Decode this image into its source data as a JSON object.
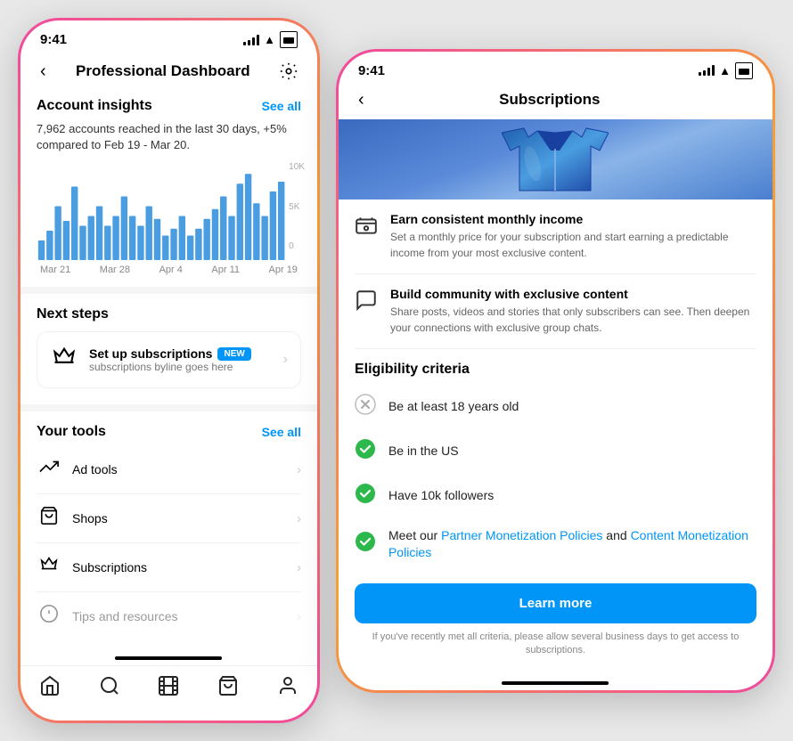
{
  "left_phone": {
    "status": {
      "time": "9:41"
    },
    "header": {
      "title": "Professional Dashboard",
      "back_label": "‹",
      "settings_icon": "⚙"
    },
    "account_insights": {
      "section_title": "Account insights",
      "see_all": "See all",
      "description": "7,962 accounts reached in the last 30 days, +5% compared to Feb 19 - Mar 20.",
      "chart": {
        "y_labels": [
          "10K",
          "5K",
          "0"
        ],
        "x_labels": [
          "Mar 21",
          "Mar 28",
          "Apr 4",
          "Apr 11",
          "Apr 19"
        ],
        "bars": [
          2,
          3,
          5,
          4,
          7,
          3,
          4,
          5,
          3,
          4,
          6,
          4,
          3,
          5,
          4,
          2,
          3,
          4,
          2,
          3,
          4,
          5,
          6,
          4,
          7,
          8,
          5,
          4,
          6,
          7
        ]
      }
    },
    "next_steps": {
      "section_title": "Next steps",
      "item": {
        "icon": "♛",
        "title": "Set up subscriptions",
        "byline": "subscriptions byline goes here",
        "badge": "NEW"
      }
    },
    "your_tools": {
      "section_title": "Your tools",
      "see_all": "See all",
      "items": [
        {
          "icon": "↗",
          "name": "Ad tools"
        },
        {
          "icon": "🛍",
          "name": "Shops"
        },
        {
          "icon": "♛",
          "name": "Subscriptions"
        },
        {
          "icon": "💡",
          "name": "Tips and resources"
        }
      ]
    },
    "bottom_nav": {
      "items": [
        "🏠",
        "🔍",
        "▶",
        "🛍",
        "👤"
      ]
    }
  },
  "right_phone": {
    "status": {
      "time": "9:41"
    },
    "header": {
      "title": "Subscriptions",
      "back_label": "‹"
    },
    "features": [
      {
        "icon": "💰",
        "title": "Earn consistent monthly income",
        "desc": "Set a monthly price for your subscription and start earning a predictable income from your most exclusive content."
      },
      {
        "icon": "💬",
        "title": "Build community with exclusive content",
        "desc": "Share posts, videos and stories that only subscribers can see. Then deepen your connections with exclusive group chats."
      }
    ],
    "eligibility": {
      "title": "Eligibility criteria",
      "criteria": [
        {
          "met": false,
          "text": "Be at least 18 years old"
        },
        {
          "met": true,
          "text": "Be in the US"
        },
        {
          "met": true,
          "text": "Have 10k followers"
        },
        {
          "met": true,
          "text": "Meet our Partner Monetization Policies and Content Monetization Policies",
          "has_links": true
        }
      ]
    },
    "learn_more_btn": "Learn more",
    "footer_note": "If you've recently met all criteria, please allow several business days to get access to subscriptions."
  }
}
